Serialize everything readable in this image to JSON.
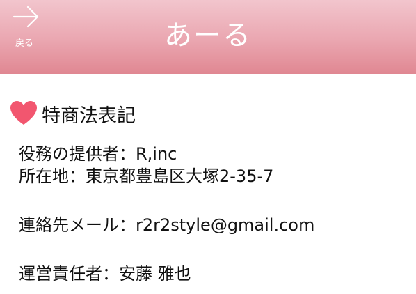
{
  "header": {
    "back_label": "戻る",
    "title": "あーる"
  },
  "section": {
    "title": "特商法表記"
  },
  "info": {
    "service_provider": "役務の提供者：R,inc",
    "address": "所在地：東京都豊島区大塚2-35-7",
    "email": "連絡先メール：r2r2style@gmail.com",
    "manager": "運営責任者：安藤 雅也"
  },
  "colors": {
    "header_top": "#f2c5cd",
    "header_bottom": "#e08792",
    "heart": "#f2566f"
  }
}
